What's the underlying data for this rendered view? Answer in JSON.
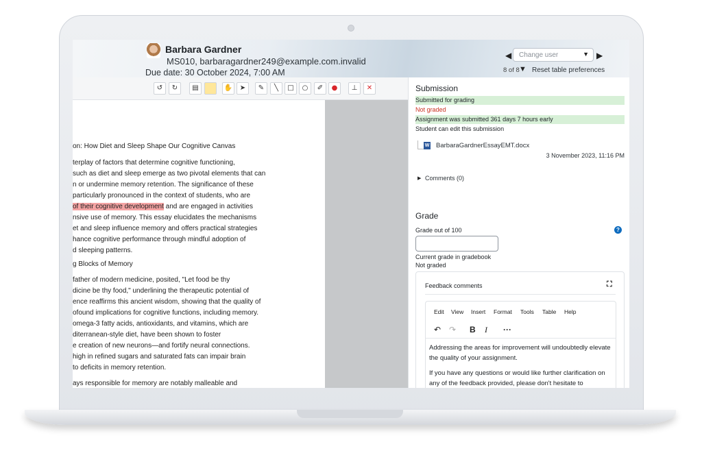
{
  "student": {
    "name": "Barbara Gardner",
    "email": "MS010, barbaragardner249@example.com.invalid",
    "due_date": "Due date: 30 October 2024, 7:00 AM"
  },
  "user_nav": {
    "prev": "◀",
    "next": "▶",
    "select_placeholder": "Change user",
    "count": "8 of 8",
    "reset": "Reset table preferences"
  },
  "toolbar": {
    "tools": [
      "rotate-left-icon",
      "rotate-right-icon",
      "comment-icon",
      "highlight-color-icon",
      "pan-icon",
      "select-icon",
      "pen-icon",
      "line-icon",
      "rectangle-icon",
      "oval-icon",
      "highlighter-icon",
      "color-picker-icon",
      "stamp-icon",
      "delete-icon"
    ]
  },
  "document": {
    "title": "on: How Diet and Sleep Shape Our Cognitive Canvas",
    "paragraph1": [
      "terplay of factors that determine cognitive functioning,",
      "such as diet and sleep emerge as two pivotal elements that can",
      "n or undermine memory retention. The significance of these",
      "particularly pronounced in the context of students, who are"
    ],
    "highlighted": "of their cognitive development",
    "after_highlight": " and are engaged in activities",
    "paragraph1b": [
      "nsive use of memory. This essay elucidates the mechanisms",
      "et and sleep influence memory and offers practical strategies",
      "hance cognitive performance through mindful adoption of",
      "d sleeping patterns."
    ],
    "heading2": "g Blocks of Memory",
    "paragraph2": [
      "father of modern medicine, posited, \"Let food be thy",
      "dicine be thy food,\" underlining the therapeutic potential of",
      "ence reaffirms this ancient wisdom, showing that the quality of",
      "ofound implications for cognitive functions, including memory.",
      "omega-3 fatty acids, antioxidants, and vitamins, which are",
      "diterranean-style diet, have been shown to foster",
      "e creation of new neurons—and fortify neural connections.",
      "high in refined sugars and saturated fats can impair brain",
      "to deficits in memory retention."
    ],
    "paragraph3": "ays responsible for memory are notably malleable and"
  },
  "submission": {
    "title": "Submission",
    "status_submitted": "Submitted for grading",
    "status_not_graded": "Not graded",
    "status_early": "Assignment was submitted 361 days 7 hours early",
    "status_editable": "Student can edit this submission",
    "file_name": "BarbaraGardnerEssayEMT.docx",
    "file_date": "3 November 2023, 11:16 PM",
    "comments": "Comments (0)"
  },
  "grade": {
    "title": "Grade",
    "label": "Grade out of 100",
    "value": "",
    "current_label": "Current grade in gradebook",
    "current_value": "Not graded"
  },
  "feedback": {
    "title": "Feedback comments",
    "menu": [
      "Edit",
      "View",
      "Insert",
      "Format",
      "Tools",
      "Table",
      "Help"
    ],
    "text1": "Addressing the areas for improvement will undoubtedly elevate the quality of your assignment.",
    "text2": "If you have any questions or would like further clarification on any of the feedback provided, please don't hesitate to"
  },
  "colors": {
    "success_bg": "#d7f0d7",
    "danger_text": "#ca3120",
    "primary": "#0f6cbf",
    "highlight": "#f4a3a3"
  }
}
